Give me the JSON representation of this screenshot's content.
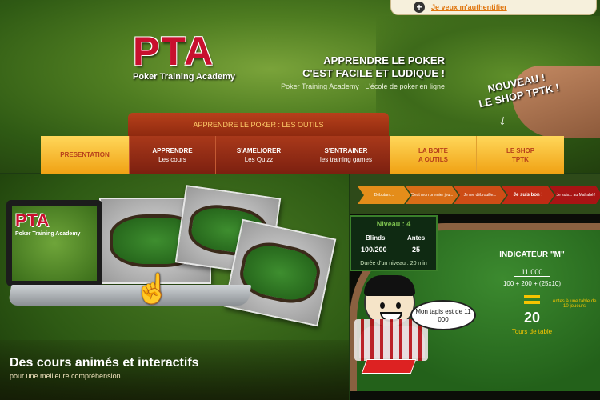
{
  "header": {
    "auth_link": "Je veux m'authentifier",
    "logo_big": "PTA",
    "logo_sub": "Poker Training Academy",
    "tagline_line1": "APPRENDRE LE POKER",
    "tagline_line2": "C'EST FACILE ET LUDIQUE !",
    "tagline_sub": "Poker Training Academy : L'école de poker en ligne",
    "promo_line1": "NOUVEAU !",
    "promo_line2": "LE SHOP TPTK !"
  },
  "menu": {
    "submenu_title": "APPRENDRE LE POKER : LES OUTILS",
    "items": [
      {
        "title": "PRESENTATION",
        "sub": ""
      },
      {
        "title": "APPRENDRE",
        "sub": "Les cours"
      },
      {
        "title": "S'AMELIORER",
        "sub": "Les Quizz"
      },
      {
        "title": "S'ENTRAINER",
        "sub": "les training games"
      },
      {
        "title": "LA BOITE",
        "sub": "A OUTILS"
      },
      {
        "title": "LE SHOP",
        "sub": "TPTK"
      }
    ]
  },
  "left_panel": {
    "caption_title": "Des cours animés et interactifs",
    "caption_sub": "pour une meilleure compréhension",
    "screen_logo": "PTA",
    "screen_sub": "Poker Training Academy"
  },
  "right_panel": {
    "steps": [
      "Débutant...",
      "C'est mon premier jeu...",
      "Je me débrouille...",
      "Je suis bon !",
      "Je suis... au Mahahé !"
    ],
    "blinds_header": "Niveau : 4",
    "blinds_label": "Blinds",
    "antes_label": "Antes",
    "blinds_value": "100/200",
    "antes_value": "25",
    "level_duration": "Durée d'un niveau : 20 min",
    "indicator_title": "INDICATEUR \"M\"",
    "numerator": "11 000",
    "denominator": "100 + 200 + (25x10)",
    "result": "20",
    "result_unit": "Tours de table",
    "note": "Antes à une table de 10 joueurs",
    "speech": "Mon tapis est de 11 000"
  },
  "colors": {
    "brand_red": "#c8102e",
    "menu_yellow": "#f0a214",
    "menu_red": "#8f2a0f",
    "link_orange": "#e0760e"
  }
}
